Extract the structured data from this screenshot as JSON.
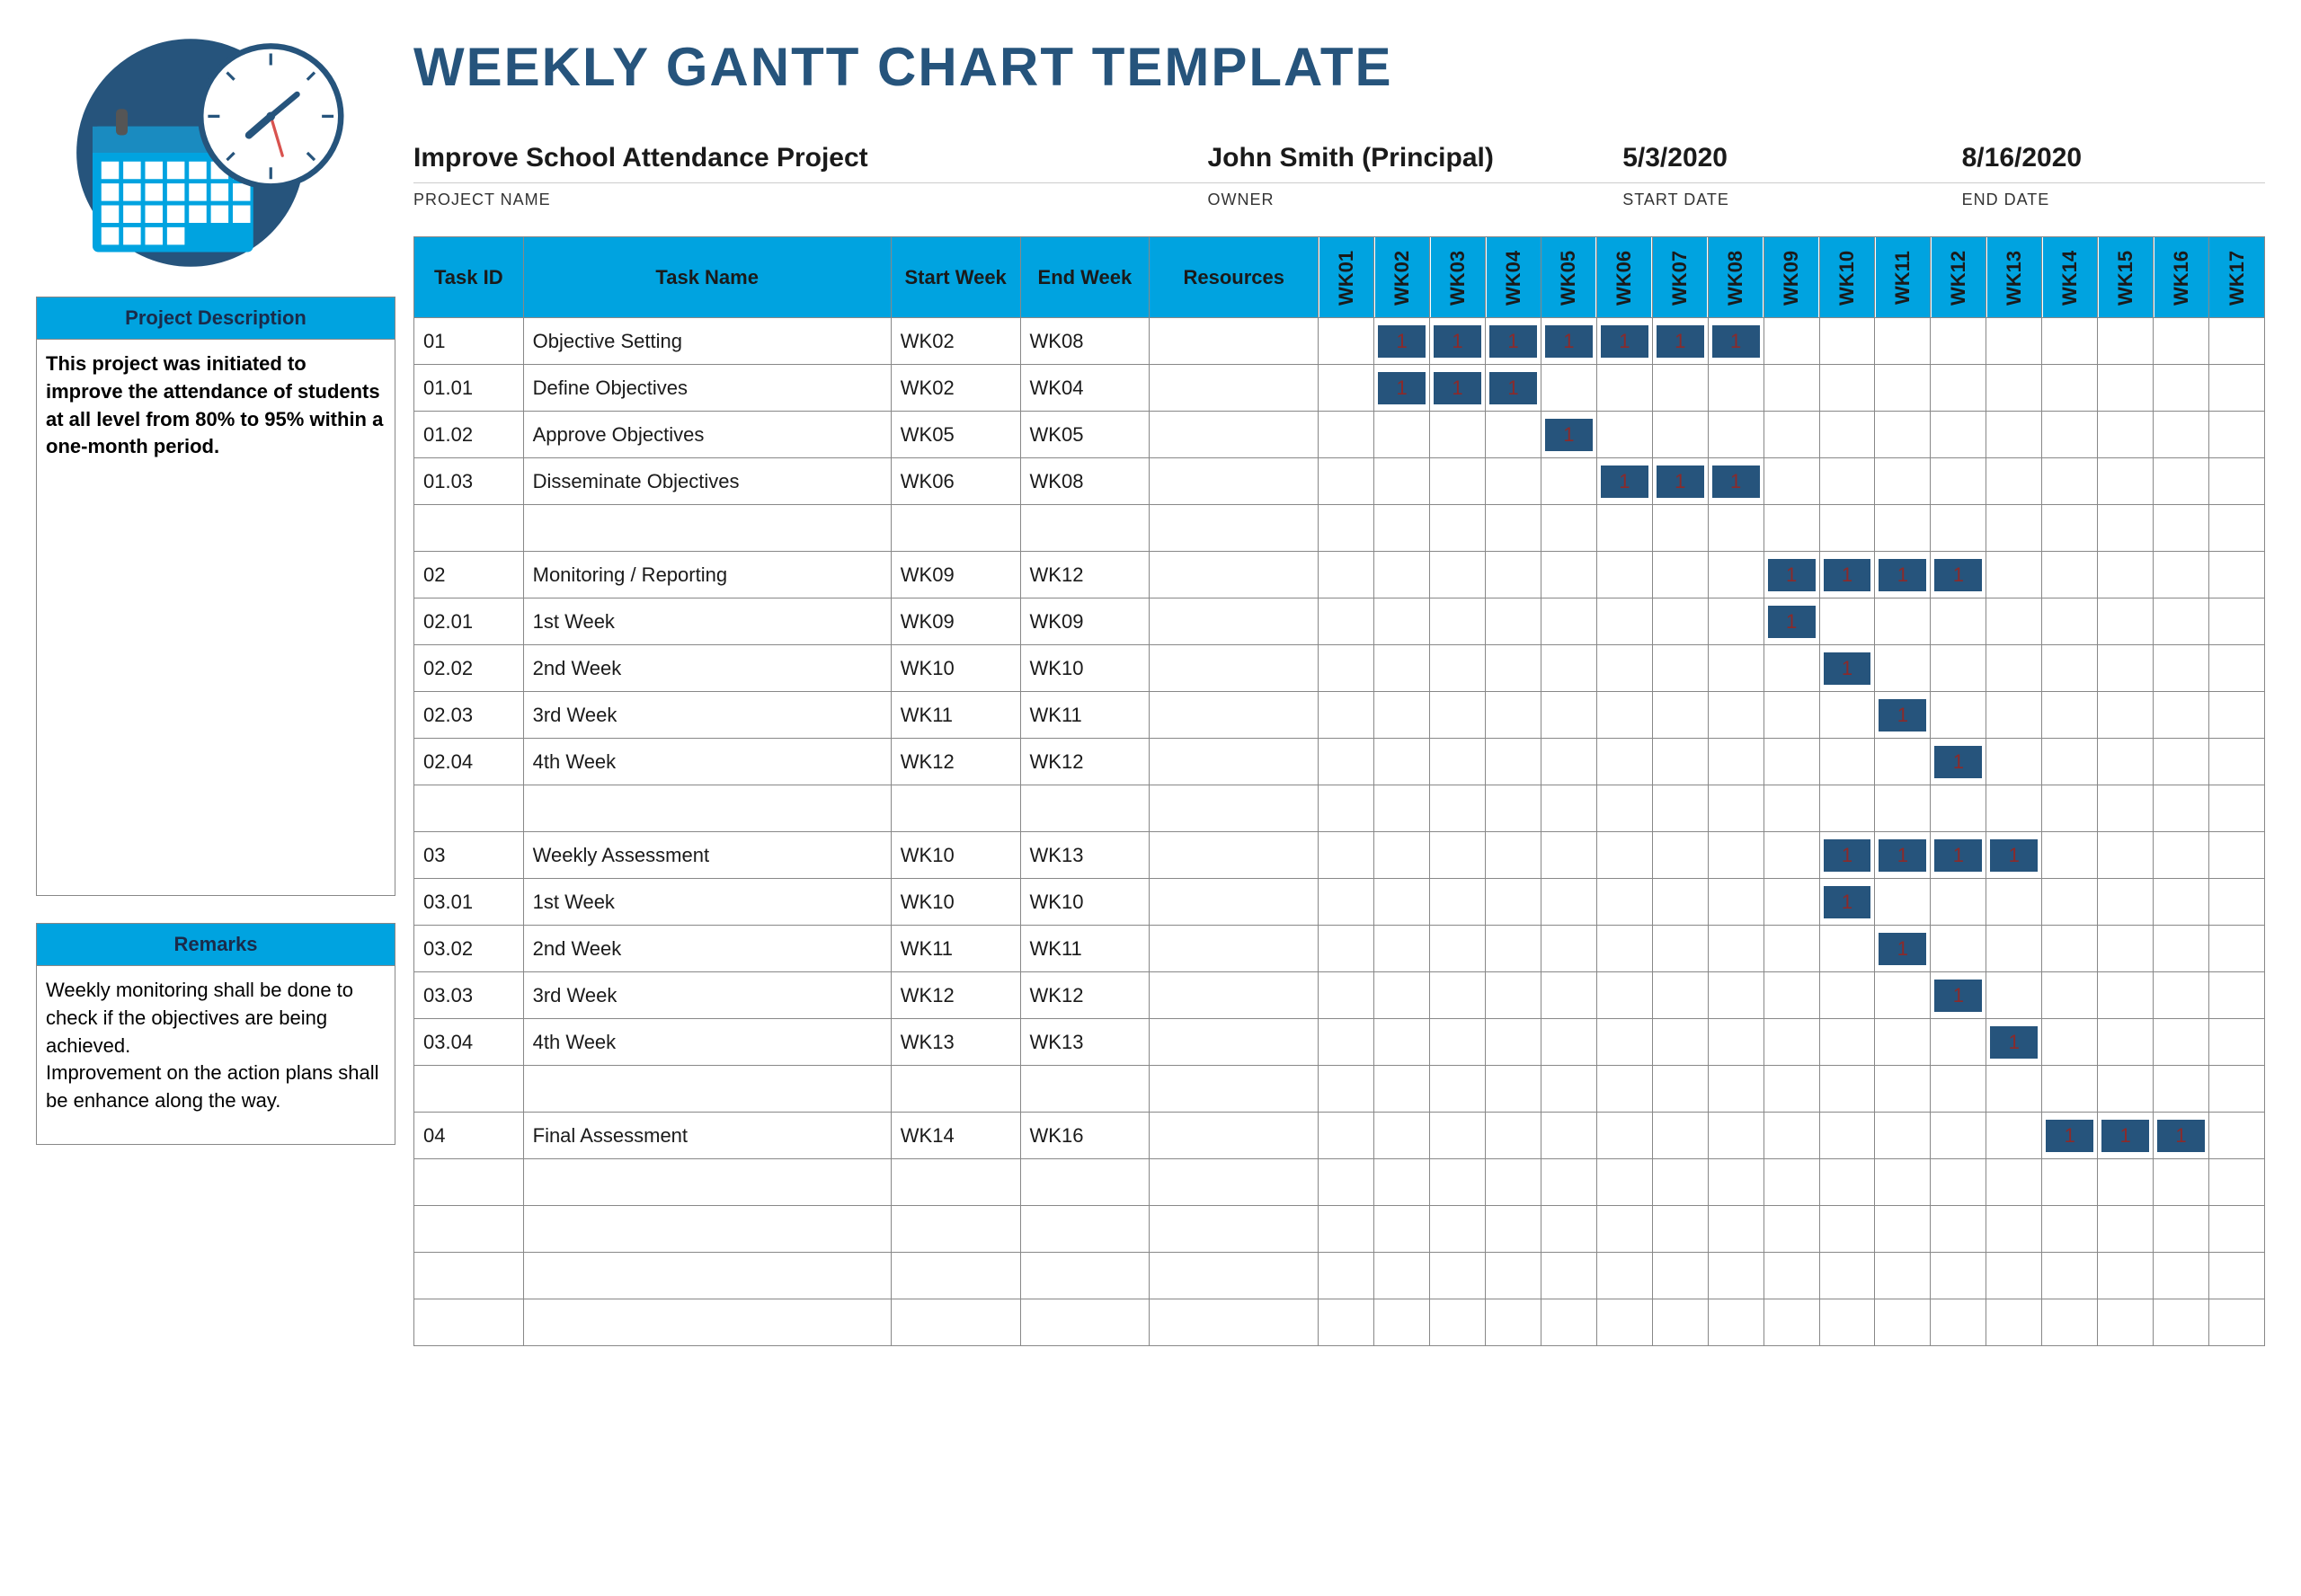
{
  "title": "WEEKLY GANTT CHART TEMPLATE",
  "meta": {
    "project_name": {
      "value": "Improve School Attendance Project",
      "label": "PROJECT NAME"
    },
    "owner": {
      "value": "John Smith (Principal)",
      "label": "OWNER"
    },
    "start_date": {
      "value": "5/3/2020",
      "label": "START DATE"
    },
    "end_date": {
      "value": "8/16/2020",
      "label": "END DATE"
    }
  },
  "sidebar": {
    "desc_header": "Project Description",
    "desc_body": "This project was initiated to improve the attendance of students at all level from 80% to 95% within a one-month period.",
    "remarks_header": "Remarks",
    "remarks_body": "Weekly monitoring shall be done to check if the objectives are being achieved.\nImprovement on the action plans shall be enhance along the way."
  },
  "columns": {
    "task_id": "Task ID",
    "task_name": "Task Name",
    "start_week": "Start Week",
    "end_week": "End Week",
    "resources": "Resources"
  },
  "weeks": [
    "WK01",
    "WK02",
    "WK03",
    "WK04",
    "WK05",
    "WK06",
    "WK07",
    "WK08",
    "WK09",
    "WK10",
    "WK11",
    "WK12",
    "WK13",
    "WK14",
    "WK15",
    "WK16",
    "WK17"
  ],
  "chart_data": {
    "type": "gantt",
    "title": "Weekly Gantt Chart — Improve School Attendance Project",
    "x_labels": [
      "WK01",
      "WK02",
      "WK03",
      "WK04",
      "WK05",
      "WK06",
      "WK07",
      "WK08",
      "WK09",
      "WK10",
      "WK11",
      "WK12",
      "WK13",
      "WK14",
      "WK15",
      "WK16",
      "WK17"
    ],
    "tasks": [
      {
        "id": "01",
        "name": "Objective Setting",
        "start": "WK02",
        "end": "WK08",
        "bars": [
          2,
          3,
          4,
          5,
          6,
          7,
          8
        ]
      },
      {
        "id": "01.01",
        "name": "Define Objectives",
        "start": "WK02",
        "end": "WK04",
        "bars": [
          2,
          3,
          4
        ]
      },
      {
        "id": "01.02",
        "name": "Approve Objectives",
        "start": "WK05",
        "end": "WK05",
        "bars": [
          5
        ]
      },
      {
        "id": "01.03",
        "name": "Disseminate Objectives",
        "start": "WK06",
        "end": "WK08",
        "bars": [
          6,
          7,
          8
        ]
      },
      {
        "id": "",
        "name": "",
        "start": "",
        "end": "",
        "bars": []
      },
      {
        "id": "02",
        "name": "Monitoring / Reporting",
        "start": "WK09",
        "end": "WK12",
        "bars": [
          9,
          10,
          11,
          12
        ]
      },
      {
        "id": "02.01",
        "name": "1st Week",
        "start": "WK09",
        "end": "WK09",
        "bars": [
          9
        ]
      },
      {
        "id": "02.02",
        "name": "2nd Week",
        "start": "WK10",
        "end": "WK10",
        "bars": [
          10
        ]
      },
      {
        "id": "02.03",
        "name": "3rd Week",
        "start": "WK11",
        "end": "WK11",
        "bars": [
          11
        ]
      },
      {
        "id": "02.04",
        "name": "4th Week",
        "start": "WK12",
        "end": "WK12",
        "bars": [
          12
        ]
      },
      {
        "id": "",
        "name": "",
        "start": "",
        "end": "",
        "bars": []
      },
      {
        "id": "03",
        "name": "Weekly Assessment",
        "start": "WK10",
        "end": "WK13",
        "bars": [
          10,
          11,
          12,
          13
        ]
      },
      {
        "id": "03.01",
        "name": "1st Week",
        "start": "WK10",
        "end": "WK10",
        "bars": [
          10
        ]
      },
      {
        "id": "03.02",
        "name": "2nd Week",
        "start": "WK11",
        "end": "WK11",
        "bars": [
          11
        ]
      },
      {
        "id": "03.03",
        "name": "3rd Week",
        "start": "WK12",
        "end": "WK12",
        "bars": [
          12
        ]
      },
      {
        "id": "03.04",
        "name": "4th Week",
        "start": "WK13",
        "end": "WK13",
        "bars": [
          13
        ]
      },
      {
        "id": "",
        "name": "",
        "start": "",
        "end": "",
        "bars": []
      },
      {
        "id": "04",
        "name": "Final Assessment",
        "start": "WK14",
        "end": "WK16",
        "bars": [
          14,
          15,
          16
        ]
      },
      {
        "id": "",
        "name": "",
        "start": "",
        "end": "",
        "bars": []
      },
      {
        "id": "",
        "name": "",
        "start": "",
        "end": "",
        "bars": []
      },
      {
        "id": "",
        "name": "",
        "start": "",
        "end": "",
        "bars": []
      },
      {
        "id": "",
        "name": "",
        "start": "",
        "end": "",
        "bars": []
      }
    ],
    "colors": {
      "bar": "#26547C",
      "header": "#00A3E0"
    }
  }
}
